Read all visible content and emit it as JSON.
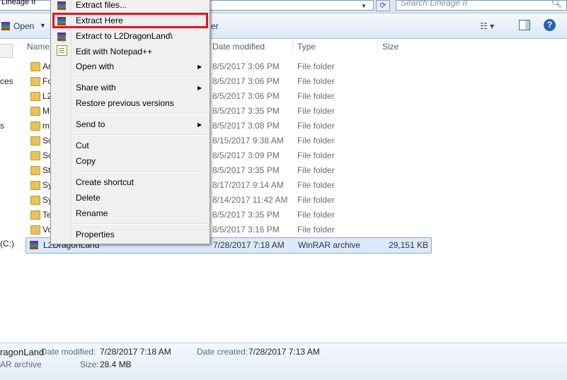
{
  "address": {
    "path": "Lineage II",
    "refresh_glyph": "⟳"
  },
  "search": {
    "placeholder": "Search Lineage II",
    "icon": "magnifier-icon"
  },
  "toolbar": {
    "open_label": "Open",
    "right_fragment": "er",
    "view_glyph": "☷ ▾",
    "help_glyph": "?"
  },
  "nav_fragments": [
    "ces",
    "s",
    "(C:)"
  ],
  "columns": {
    "name": "Name",
    "date": "Date modified",
    "type": "Type",
    "size": "Size"
  },
  "rows": [
    {
      "name": "Ar",
      "date": "8/5/2017 3:06 PM",
      "type": "File folder",
      "size": ""
    },
    {
      "name": "Fo",
      "date": "8/5/2017 3:06 PM",
      "type": "File folder",
      "size": ""
    },
    {
      "name": "L2",
      "date": "8/5/2017 3:06 PM",
      "type": "File folder",
      "size": ""
    },
    {
      "name": "M",
      "date": "8/5/2017 3:35 PM",
      "type": "File folder",
      "size": ""
    },
    {
      "name": "m",
      "date": "8/5/2017 3:08 PM",
      "type": "File folder",
      "size": ""
    },
    {
      "name": "Sc",
      "date": "8/15/2017 9:38 AM",
      "type": "File folder",
      "size": ""
    },
    {
      "name": "So",
      "date": "8/5/2017 3:09 PM",
      "type": "File folder",
      "size": ""
    },
    {
      "name": "Sta",
      "date": "8/5/2017 3:35 PM",
      "type": "File folder",
      "size": ""
    },
    {
      "name": "Sy",
      "date": "8/17/2017 9:14 AM",
      "type": "File folder",
      "size": ""
    },
    {
      "name": "Sy",
      "date": "8/14/2017 11:42 AM",
      "type": "File folder",
      "size": ""
    },
    {
      "name": "Te",
      "date": "8/5/2017 3:35 PM",
      "type": "File folder",
      "size": ""
    },
    {
      "name": "Vo",
      "date": "8/5/2017 3:16 PM",
      "type": "File folder",
      "size": ""
    },
    {
      "name": "L2DragonLand",
      "date": "7/28/2017 7:18 AM",
      "type": "WinRAR archive",
      "size": "29,151 KB",
      "selected": true
    }
  ],
  "context_menu": {
    "items": [
      {
        "label": "Extract files...",
        "icon": "winrar-icon"
      },
      {
        "label": "Extract Here",
        "icon": "winrar-icon",
        "highlighted": true
      },
      {
        "label": "Extract to L2DragonLand\\",
        "icon": "winrar-icon"
      },
      {
        "label": "Edit with Notepad++",
        "icon": "notepad-plus-plus-icon"
      },
      {
        "label": "Open with",
        "submenu": true
      },
      {
        "label": "Share with",
        "submenu": true
      },
      {
        "label": "Restore previous versions"
      },
      {
        "label": "Send to",
        "submenu": true
      },
      {
        "label": "Cut"
      },
      {
        "label": "Copy"
      },
      {
        "label": "Create shortcut"
      },
      {
        "label": "Delete"
      },
      {
        "label": "Rename"
      },
      {
        "label": "Properties"
      }
    ],
    "submenu_glyph": "▶",
    "highlight_color": "#e81123"
  },
  "details": {
    "name_fragment": "ragonLand",
    "type_fragment": "AR archive",
    "date_modified_label": "Date modified:",
    "date_modified_value": "7/28/2017 7:18 AM",
    "size_label": "Size:",
    "size_value": "28.4 MB",
    "date_created_label": "Date created:",
    "date_created_value": "7/28/2017 7:13 AM"
  }
}
